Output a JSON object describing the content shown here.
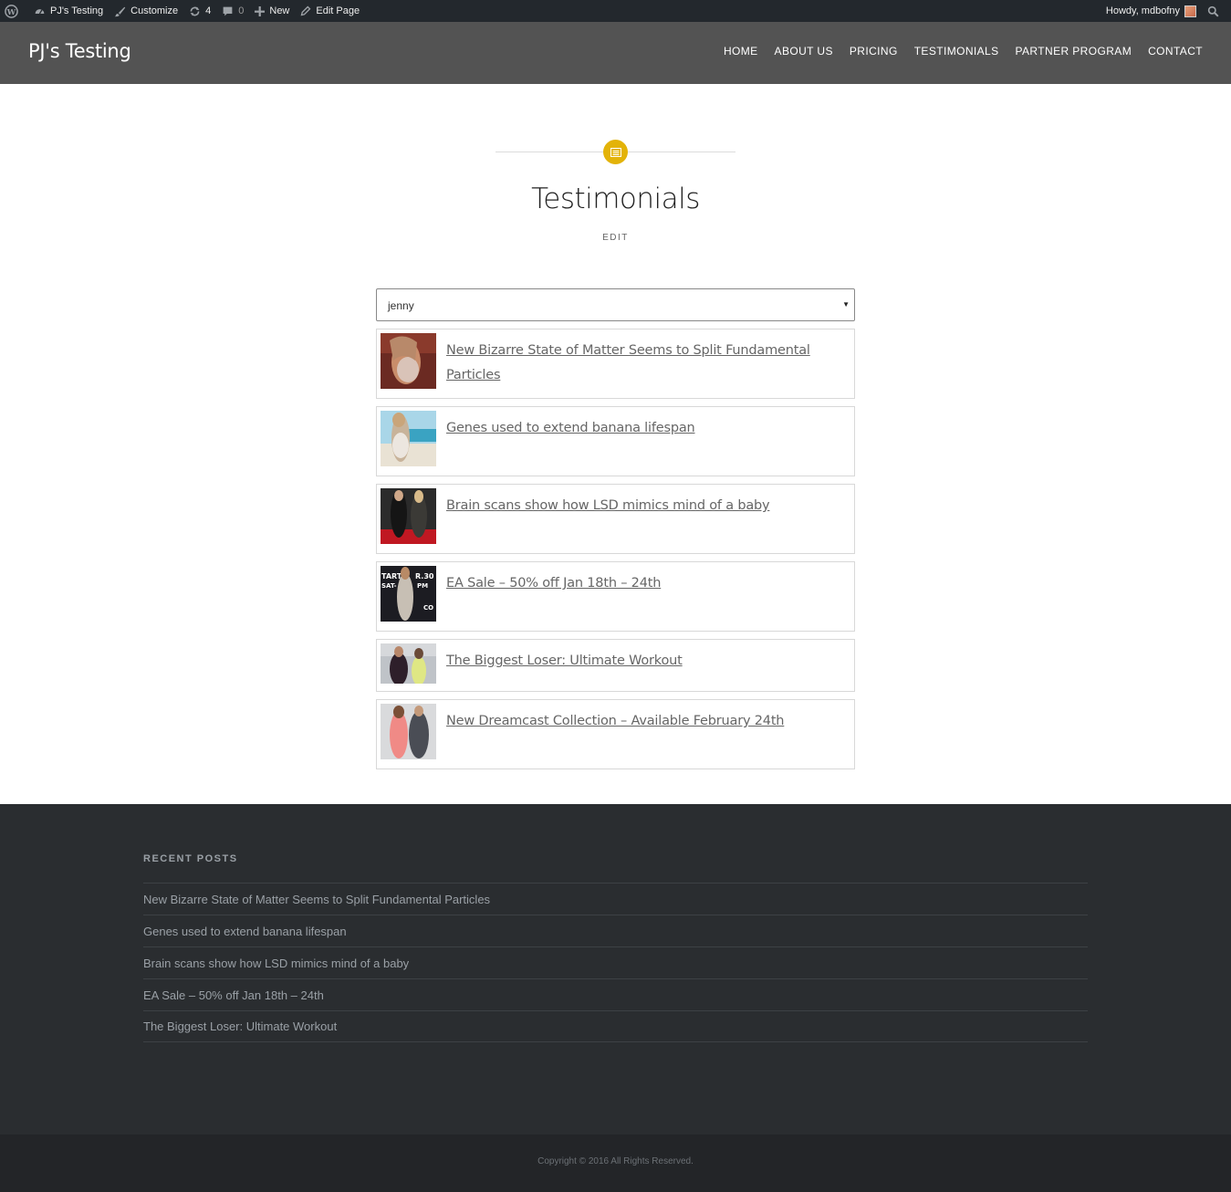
{
  "admin_bar": {
    "site_name": "PJ's Testing",
    "customize": "Customize",
    "updates_count": "4",
    "comments_count": "0",
    "new": "New",
    "edit_page": "Edit Page",
    "howdy": "Howdy, mdbofny"
  },
  "header": {
    "site_title": "PJ's Testing",
    "nav": [
      "HOME",
      "ABOUT US",
      "PRICING",
      "TESTIMONIALS",
      "PARTNER PROGRAM",
      "CONTACT"
    ]
  },
  "page": {
    "title": "Testimonials",
    "edit_label": "EDIT",
    "select_value": "jenny"
  },
  "posts": [
    {
      "title": "New Bizarre State of Matter Seems to Split Fundamental Particles"
    },
    {
      "title": "Genes used to extend banana lifespan"
    },
    {
      "title": "Brain scans show how LSD mimics mind of a baby"
    },
    {
      "title": "EA Sale – 50% off Jan 18th – 24th"
    },
    {
      "title": "The Biggest Loser: Ultimate Workout"
    },
    {
      "title": "New Dreamcast Collection – Available February 24th"
    }
  ],
  "footer": {
    "widget_title": "RECENT POSTS",
    "recent_posts": [
      "New Bizarre State of Matter Seems to Split Fundamental Particles",
      "Genes used to extend banana lifespan",
      "Brain scans show how LSD mimics mind of a baby",
      "EA Sale – 50% off Jan 18th – 24th",
      "The Biggest Loser: Ultimate Workout"
    ],
    "copyright": "Copyright © 2016 All Rights Reserved."
  },
  "colors": {
    "admin_bar_bg": "#23282d",
    "header_bg": "#535353",
    "accent": "#e3b309",
    "footer_bg": "#2a2d30",
    "bottom_bar_bg": "#232528"
  }
}
